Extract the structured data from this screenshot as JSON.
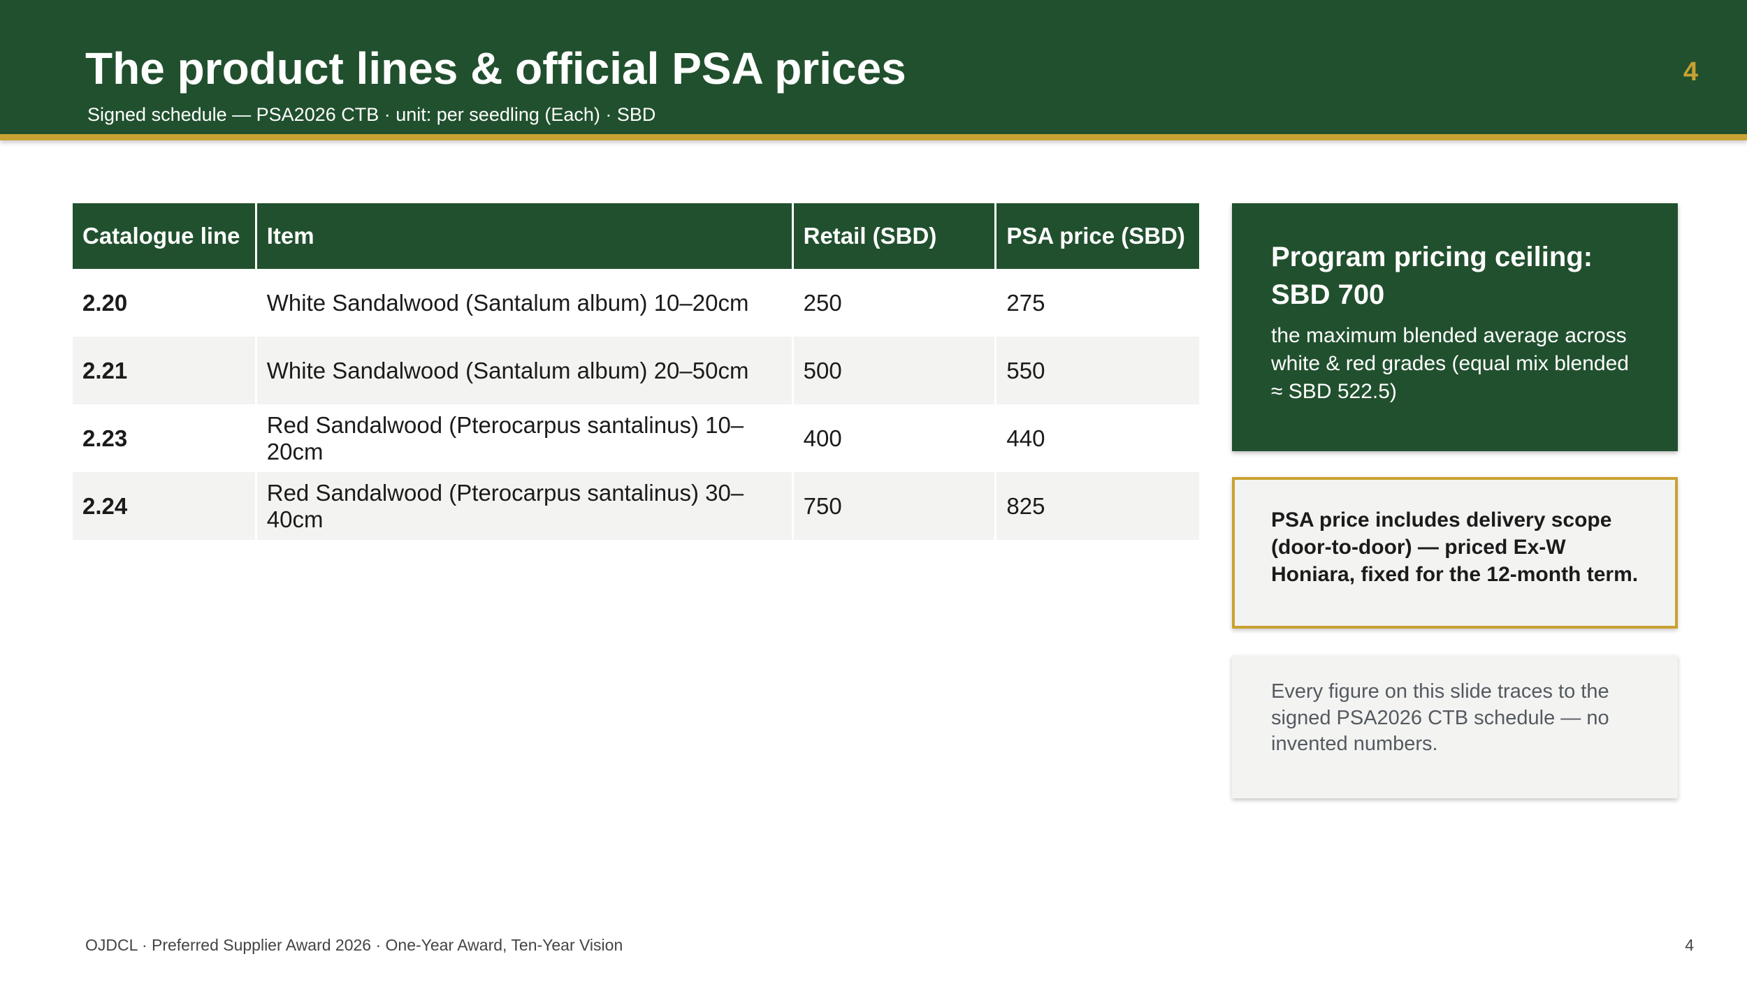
{
  "header": {
    "title": "The product lines & official PSA prices",
    "subtitle": "Signed schedule — PSA2026 CTB · unit: per seedling (Each) · SBD",
    "page_number": "4"
  },
  "table": {
    "columns": [
      "Catalogue line",
      "Item",
      "Retail (SBD)",
      "PSA price (SBD)"
    ],
    "rows": [
      {
        "line": "2.20",
        "item": "White Sandalwood (Santalum album) 10–20cm",
        "retail": "250",
        "psa": "275"
      },
      {
        "line": "2.21",
        "item": "White Sandalwood (Santalum album) 20–50cm",
        "retail": "500",
        "psa": "550"
      },
      {
        "line": "2.23",
        "item": "Red Sandalwood (Pterocarpus santalinus) 10–20cm",
        "retail": "400",
        "psa": "440"
      },
      {
        "line": "2.24",
        "item": "Red Sandalwood (Pterocarpus santalinus) 30–40cm",
        "retail": "750",
        "psa": "825"
      }
    ]
  },
  "ceiling_card": {
    "title": "Program pricing ceiling: SBD 700",
    "text": "the maximum blended average across white & red grades (equal mix blended ≈ SBD 522.5)"
  },
  "delivery_card": {
    "text": "PSA price includes delivery scope (door-to-door) — priced Ex-W Honiara, fixed for the 12-month term."
  },
  "note_card": {
    "text": "Every figure on this slide traces to the signed PSA2026 CTB schedule — no invented numbers."
  },
  "footer": {
    "text": "OJDCL · Preferred Supplier Award 2026 · One-Year Award, Ten-Year Vision",
    "page_number": "4"
  },
  "colors": {
    "brand_green": "#21502e",
    "accent_gold": "#c8a232",
    "row_alt": "#f3f4f2"
  }
}
